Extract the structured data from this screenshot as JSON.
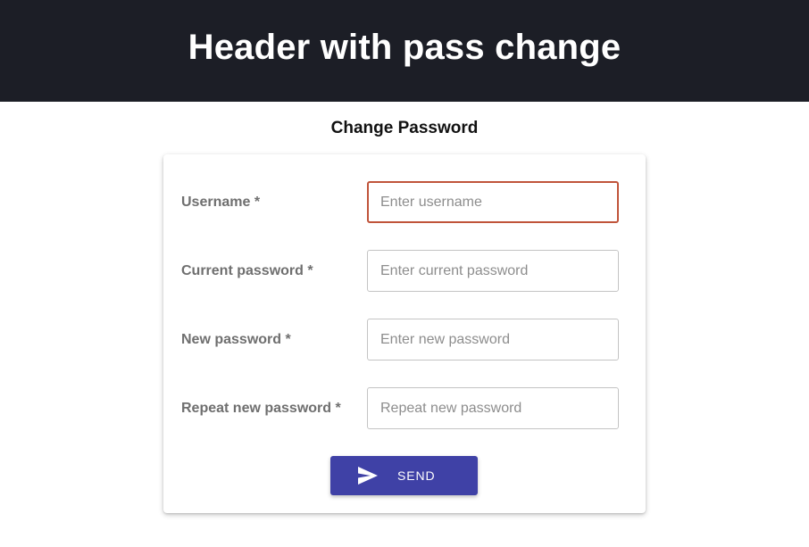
{
  "header": {
    "title": "Header with pass change"
  },
  "form": {
    "title": "Change Password",
    "fields": [
      {
        "label": "Username *",
        "placeholder": "Enter username",
        "value": "",
        "focused": true
      },
      {
        "label": "Current password *",
        "placeholder": "Enter current password",
        "value": ""
      },
      {
        "label": "New password *",
        "placeholder": "Enter new password",
        "value": ""
      },
      {
        "label": "Repeat new password *",
        "placeholder": "Repeat new password",
        "value": ""
      }
    ],
    "submit": {
      "label": "SEND",
      "icon": "send-icon"
    }
  },
  "colors": {
    "header_bg": "#1c1e26",
    "button_bg": "#3f41a6",
    "focus_border": "#c0543a"
  }
}
